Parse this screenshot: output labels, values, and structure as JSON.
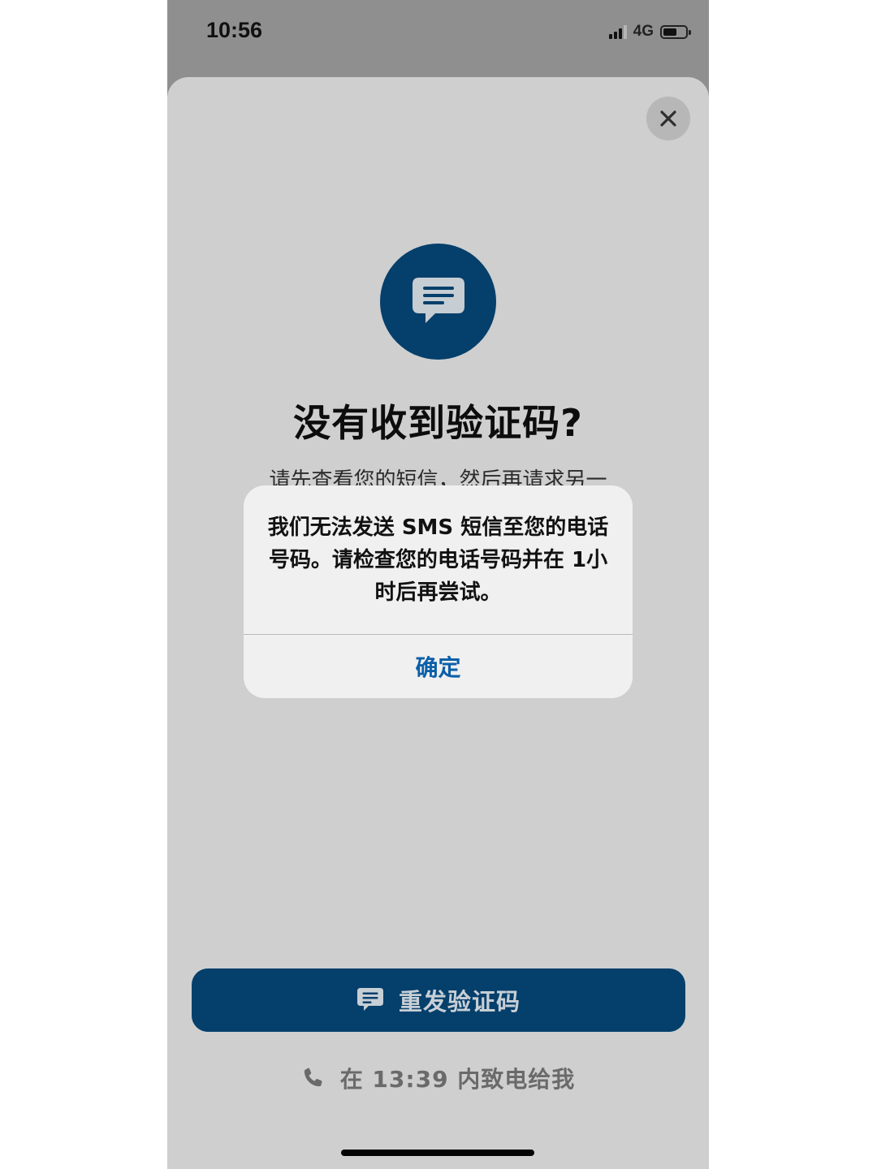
{
  "status_bar": {
    "time": "10:56",
    "network": "4G",
    "signal_icon": "cellular-signal-icon",
    "battery_icon": "battery-icon"
  },
  "sheet": {
    "close_icon": "close-icon",
    "hero_icon": "message-bubble-icon",
    "title": "没有收到验证码?",
    "description": "请先查看您的短信，然后再请求另一"
  },
  "actions": {
    "resend_label": "重发验证码",
    "resend_icon": "message-bubble-icon",
    "call_label": "在 13:39 内致电给我",
    "call_icon": "phone-icon"
  },
  "alert": {
    "message": "我们无法发送 SMS 短信至您的电话号码。请检查您的电话号码并在 1小时后再尝试。",
    "confirm_label": "确定"
  },
  "colors": {
    "brand": "#053f6b",
    "alert_button": "#0b5fa8",
    "sheet_background": "#cfcfcf",
    "dimmed_background": "#8f8f8f"
  }
}
